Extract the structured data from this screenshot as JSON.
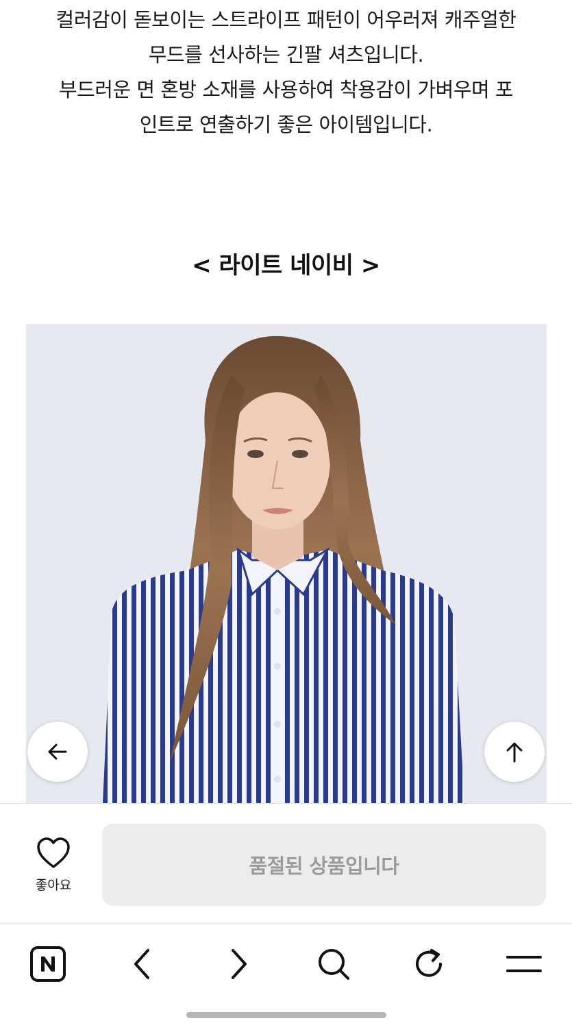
{
  "description": {
    "lines": [
      "컬러감이 돋보이는 스트라이프 패턴이 어우러져 캐주얼한",
      "무드를 선사하는 긴팔 셔츠입니다.",
      "부드러운 면 혼방 소재를 사용하여 착용감이 가벼우며 포",
      "인트로 연출하기 좋은 아이템입니다."
    ]
  },
  "color_section": {
    "title": "< 라이트 네이비 >"
  },
  "image_nav": {
    "prev_icon": "arrow-left-icon",
    "top_icon": "arrow-up-icon"
  },
  "action_bar": {
    "like_label": "좋아요",
    "like_icon": "heart-icon",
    "soldout_label": "품절된 상품입니다"
  },
  "browser_nav": {
    "icons": [
      "naver-home-icon",
      "back-chevron-icon",
      "forward-chevron-icon",
      "search-icon",
      "refresh-icon",
      "menu-icon"
    ]
  },
  "colors": {
    "soldout_bg": "#ececec",
    "soldout_text": "#9a9a9a",
    "image_bg": "#e6e9ef",
    "stripe_navy": "#2c3a8c"
  }
}
